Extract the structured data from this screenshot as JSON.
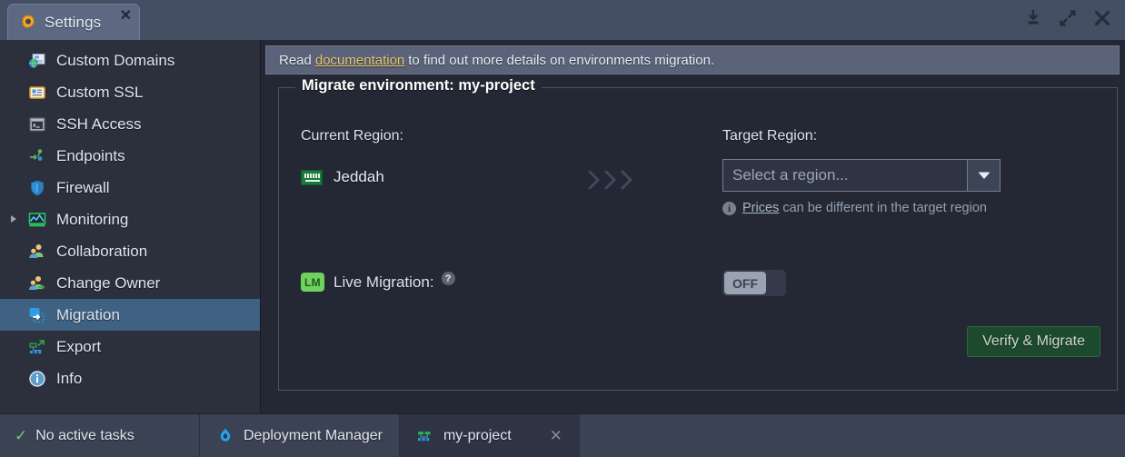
{
  "window": {
    "tab_title": "Settings",
    "tab_icon": "gear-icon",
    "tab_close_glyph": "✕",
    "controls": [
      {
        "name": "minimize-icon",
        "title": "Minimize"
      },
      {
        "name": "maximize-icon",
        "title": "Maximize"
      },
      {
        "name": "close-icon",
        "title": "Close"
      }
    ]
  },
  "sidebar": {
    "items": [
      {
        "label": "Custom Domains",
        "icon": "globe-document-icon",
        "selected": false,
        "expandable": false
      },
      {
        "label": "Custom SSL",
        "icon": "certificate-icon",
        "selected": false,
        "expandable": false
      },
      {
        "label": "SSH Access",
        "icon": "terminal-icon",
        "selected": false,
        "expandable": false
      },
      {
        "label": "Endpoints",
        "icon": "endpoints-icon",
        "selected": false,
        "expandable": false
      },
      {
        "label": "Firewall",
        "icon": "shield-icon",
        "selected": false,
        "expandable": false
      },
      {
        "label": "Monitoring",
        "icon": "chart-icon",
        "selected": false,
        "expandable": true
      },
      {
        "label": "Collaboration",
        "icon": "users-icon",
        "selected": false,
        "expandable": false
      },
      {
        "label": "Change Owner",
        "icon": "change-owner-icon",
        "selected": false,
        "expandable": false
      },
      {
        "label": "Migration",
        "icon": "migration-icon",
        "selected": true,
        "expandable": false
      },
      {
        "label": "Export",
        "icon": "export-icon",
        "selected": false,
        "expandable": false
      },
      {
        "label": "Info",
        "icon": "info-icon",
        "selected": false,
        "expandable": false
      }
    ]
  },
  "main": {
    "banner": {
      "prefix": "Read",
      "link": "documentation",
      "suffix": "to find out more details on environments migration."
    },
    "panel": {
      "legend": "Migrate environment: my-project",
      "current_region": {
        "label": "Current Region:",
        "value": "Jeddah",
        "flag": "saudi-arabia-flag-icon"
      },
      "arrows": "chevrons-right-icon",
      "target_region": {
        "label": "Target Region:",
        "placeholder": "Select a region...",
        "selected": "",
        "dropdown_glyph": "▼",
        "note_link": "Prices",
        "note_text": "can be different in the target region",
        "note_icon": "info-icon"
      },
      "live_migration": {
        "badge": "LM",
        "label": "Live Migration:",
        "help_glyph": "?",
        "toggle_state": "OFF"
      },
      "verify_button": "Verify & Migrate"
    }
  },
  "statusbar": {
    "tasks_check": "✓",
    "tasks_label": "No active tasks",
    "tabs": [
      {
        "label": "Deployment Manager",
        "icon": "deployment-manager-icon",
        "active": false,
        "closable": false
      },
      {
        "label": "my-project",
        "icon": "project-icon",
        "active": true,
        "closable": true,
        "close_glyph": "✕"
      }
    ]
  },
  "colors": {
    "titlebar": "#454f63",
    "sidebar_bg": "#2b303c",
    "main_bg": "#232834",
    "selected_item": "#3f6182",
    "banner_bg": "#5a6379",
    "link_yellow": "#e9c46a",
    "accent_green": "#1d4a2c",
    "badge_green": "#6fd15e",
    "statusbar": "#3b4253"
  }
}
